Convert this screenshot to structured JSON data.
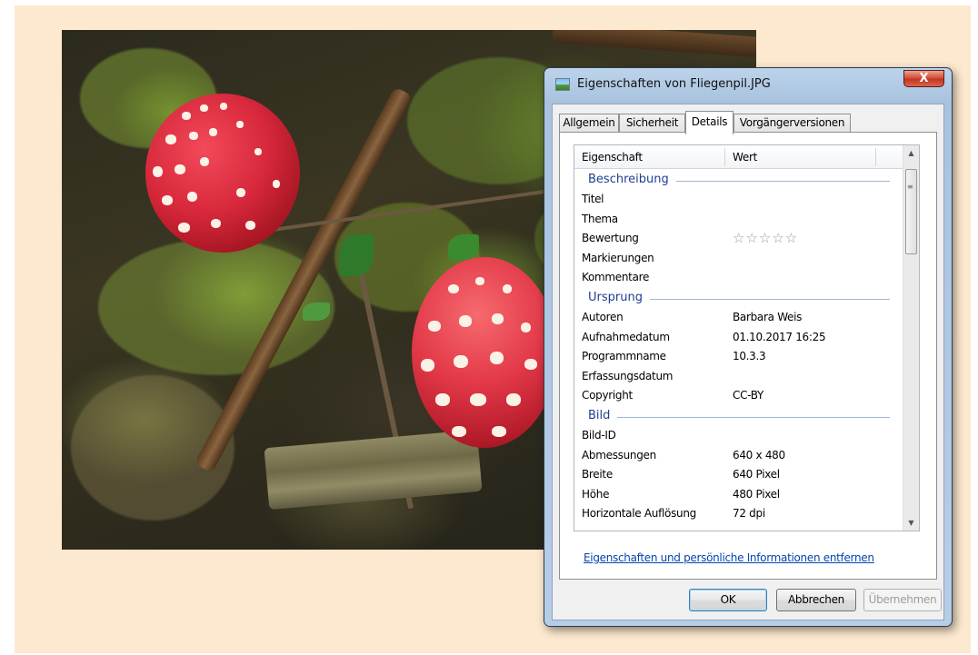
{
  "dialog": {
    "title": "Eigenschaften von Fliegenpil.JPG",
    "close_label": "X",
    "tabs": [
      {
        "label": "Allgemein"
      },
      {
        "label": "Sicherheit"
      },
      {
        "label": "Details"
      },
      {
        "label": "Vorgängerversionen"
      }
    ],
    "active_tab": "Details",
    "columns": {
      "property": "Eigenschaft",
      "value": "Wert"
    },
    "groups": {
      "beschreibung": {
        "label": "Beschreibung",
        "rows": [
          {
            "key": "Titel",
            "value": ""
          },
          {
            "key": "Thema",
            "value": ""
          },
          {
            "key": "Bewertung",
            "value": "☆☆☆☆☆"
          },
          {
            "key": "Markierungen",
            "value": ""
          },
          {
            "key": "Kommentare",
            "value": ""
          }
        ]
      },
      "ursprung": {
        "label": "Ursprung",
        "rows": [
          {
            "key": "Autoren",
            "value": "Barbara Weis"
          },
          {
            "key": "Aufnahmedatum",
            "value": "01.10.2017 16:25"
          },
          {
            "key": "Programmname",
            "value": "10.3.3"
          },
          {
            "key": "Erfassungsdatum",
            "value": ""
          },
          {
            "key": "Copyright",
            "value": "CC-BY"
          }
        ]
      },
      "bild": {
        "label": "Bild",
        "rows": [
          {
            "key": "Bild-ID",
            "value": ""
          },
          {
            "key": "Abmessungen",
            "value": "640 x 480"
          },
          {
            "key": "Breite",
            "value": "640 Pixel"
          },
          {
            "key": "Höhe",
            "value": "480 Pixel"
          },
          {
            "key": "Horizontale Auflösung",
            "value": "72 dpi"
          }
        ]
      }
    },
    "rating_stars": 0,
    "remove_link": "Eigenschaften und persönliche Informationen entfernen",
    "buttons": {
      "ok": "OK",
      "cancel": "Abbrechen",
      "apply": "Übernehmen"
    }
  },
  "colors": {
    "background": "#fde9cf",
    "group_header": "#1e3f8f",
    "link": "#0645ad",
    "close_button": "#c23620"
  }
}
